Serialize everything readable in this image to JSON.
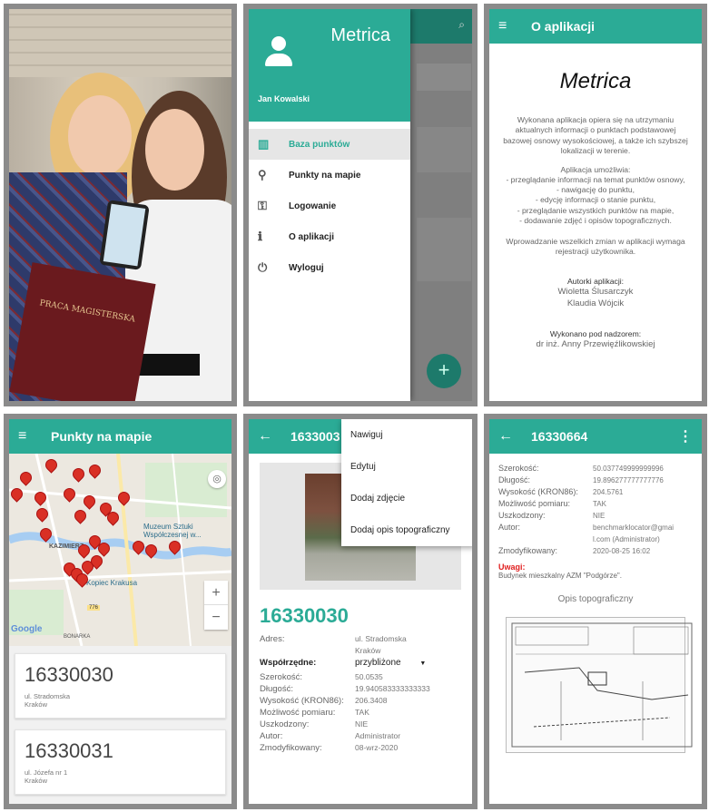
{
  "drawer_screen": {
    "app_title": "Metrica",
    "user_name": "Jan Kowalski",
    "menu": [
      {
        "label": "Baza punktów",
        "icon": "grid-icon"
      },
      {
        "label": "Punkty na mapie",
        "icon": "pin-icon"
      },
      {
        "label": "Logowanie",
        "icon": "key-icon"
      },
      {
        "label": "O aplikacji",
        "icon": "info-icon"
      },
      {
        "label": "Wyloguj",
        "icon": "power-icon"
      }
    ],
    "fab": "+"
  },
  "about_screen": {
    "title": "O aplikacji",
    "app_name": "Metrica",
    "para1": "Wykonana aplikacja opiera się na utrzymaniu aktualnych informacji o punktach podstawowej bazowej osnowy wysokościowej, a także ich szybszej lokalizacji w terenie.",
    "para2_title": "Aplikacja umożliwia:",
    "para2_items": [
      "- przeglądanie informacji na temat punktów osnowy,",
      "- nawigację do punktu,",
      "- edycję informacji o stanie punktu,",
      "- przeglądanie wszystkich punktów na mapie,",
      "- dodawanie zdjęć i opisów topograficznych."
    ],
    "para3": "Wprowadzanie wszelkich zmian w aplikacji wymaga rejestracji użytkownika.",
    "authors_label": "Autorki aplikacji:",
    "authors": [
      "Wioletta Ślusarczyk",
      "Klaudia Wójcik"
    ],
    "supervisor_label": "Wykonano pod nadzorem:",
    "supervisor": "dr inż. Anny Przewięźlikowskiej"
  },
  "map_screen": {
    "title": "Punkty na mapie",
    "labels": {
      "district": "KAZIMIERZ",
      "museum": "Muzeum Sztuki Współczesnej w...",
      "mound": "Kopiec Krakusa",
      "google": "Google",
      "bonarka": "BONARKA",
      "road": "776"
    },
    "zoom_in": "+",
    "zoom_out": "−",
    "items": [
      {
        "id": "16330030",
        "street": "ul. Stradomska",
        "city": "Kraków"
      },
      {
        "id": "16330031",
        "street": "ul. Józefa nr 1",
        "city": "Kraków"
      }
    ]
  },
  "detail_screen": {
    "title": "1633003",
    "menu": [
      "Nawiguj",
      "Edytuj",
      "Dodaj zdjęcie",
      "Dodaj opis topograficzny"
    ],
    "point_id": "16330030",
    "address_label": "Adres:",
    "address": "ul. Stradomska Kraków",
    "coords_label": "Współrzędne:",
    "coords_value": "przybliżone",
    "rows": [
      {
        "k": "Szerokość:",
        "v": "50.0535"
      },
      {
        "k": "Długość:",
        "v": "19.940583333333333"
      },
      {
        "k": "Wysokość (KRON86):",
        "v": "206.3408"
      },
      {
        "k": "Możliwość pomiaru:",
        "v": "TAK"
      },
      {
        "k": "Uszkodzony:",
        "v": "NIE"
      },
      {
        "k": "Autor:",
        "v": "Administrator"
      },
      {
        "k": "Zmodyfikowany:",
        "v": "08-wrz-2020"
      }
    ]
  },
  "detail2_screen": {
    "title": "16330664",
    "rows": [
      {
        "k": "Szerokość:",
        "v": "50.037749999999996"
      },
      {
        "k": "Długość:",
        "v": "19.896277777777776"
      },
      {
        "k": "Wysokość (KRON86):",
        "v": "204.5761"
      },
      {
        "k": "Możliwość pomiaru:",
        "v": "TAK"
      },
      {
        "k": "Uszkodzony:",
        "v": "NIE"
      },
      {
        "k": "Autor:",
        "v": "benchmarklocator@gmail.com (Administrator)"
      },
      {
        "k": "Zmodyfikowany:",
        "v": "2020-08-25 16:02"
      }
    ],
    "remarks_label": "Uwagi:",
    "remarks": "Budynek mieszkalny AZM \"Podgórze\".",
    "topo_label": "Opis topograficzny"
  },
  "photo": {
    "book_title": "PRACA MAGISTERSKA"
  },
  "colors": {
    "primary": "#2bab96",
    "remark": "#e02020",
    "pin": "#d93025"
  }
}
